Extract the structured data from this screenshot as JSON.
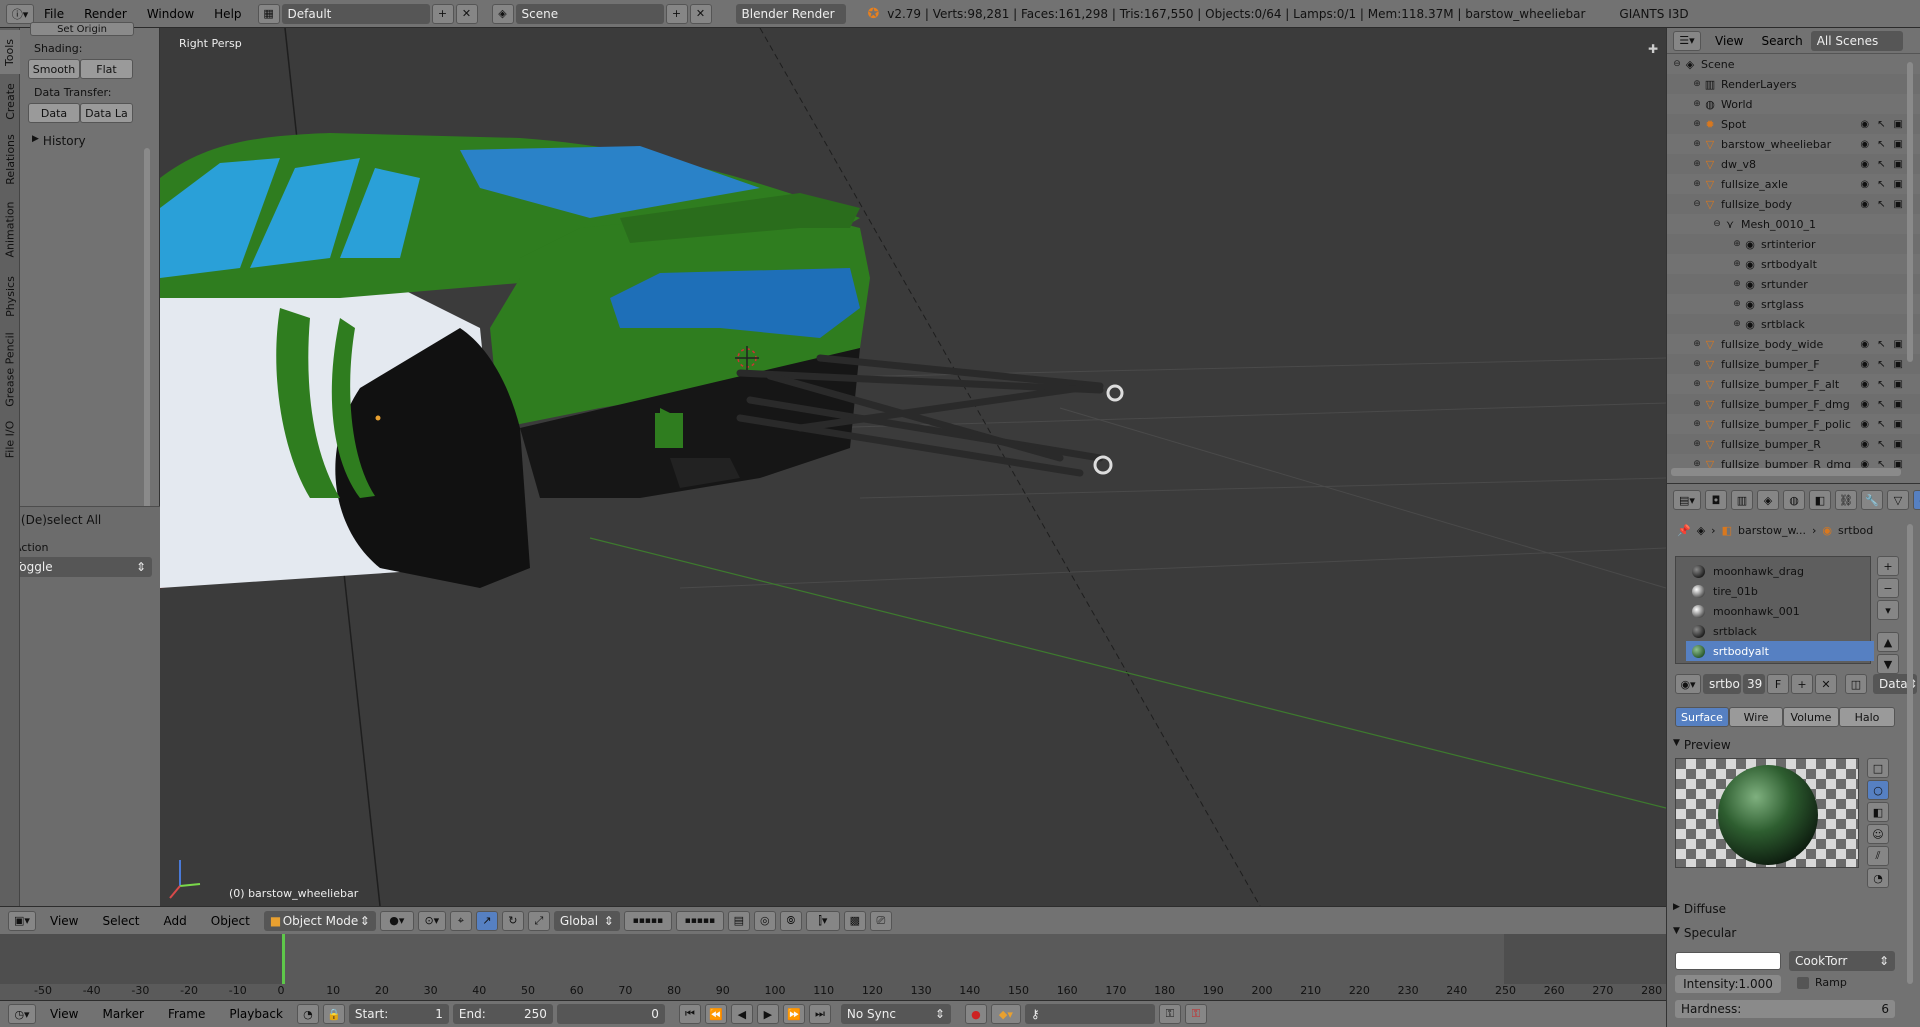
{
  "topbar": {
    "menus": [
      "File",
      "Render",
      "Window",
      "Help"
    ],
    "layout": "Default",
    "scene": "Scene",
    "engine": "Blender Render",
    "stats": "v2.79 | Verts:98,281 | Faces:161,298 | Tris:167,550 | Objects:0/64 | Lamps:0/1 | Mem:118.37M | barstow_wheeliebar",
    "addon": "GIANTS I3D"
  },
  "toolshelf": {
    "tabs": [
      "Tools",
      "Create",
      "Relations",
      "Animation",
      "Physics",
      "Grease Pencil",
      "File I/O"
    ],
    "set_origin": "Set Origin",
    "shading_label": "Shading:",
    "smooth": "Smooth",
    "flat": "Flat",
    "transfer_label": "Data Transfer:",
    "data": "Data",
    "data_la": "Data La",
    "history": "History",
    "op_title": "(De)select All",
    "action_label": "Action",
    "action_value": "Toggle"
  },
  "viewport": {
    "view_name": "Right Persp",
    "object_label": "(0) barstow_wheeliebar"
  },
  "vheader": {
    "menus": [
      "View",
      "Select",
      "Add",
      "Object"
    ],
    "mode": "Object Mode",
    "orientation": "Global"
  },
  "timeline": {
    "ticks": [
      "-50",
      "-40",
      "-30",
      "-20",
      "-10",
      "0",
      "10",
      "20",
      "30",
      "40",
      "50",
      "60",
      "70",
      "80",
      "90",
      "100",
      "110",
      "120",
      "130",
      "140",
      "150",
      "160",
      "170",
      "180",
      "190",
      "200",
      "210",
      "220",
      "230",
      "240",
      "250",
      "260",
      "270",
      "280"
    ],
    "current_frame_tick": "0"
  },
  "tlheader": {
    "menus": [
      "View",
      "Marker",
      "Frame",
      "Playback"
    ],
    "start_label": "Start:",
    "start": "1",
    "end_label": "End:",
    "end": "250",
    "frame": "0",
    "sync": "No Sync"
  },
  "outliner": {
    "menus": [
      "View",
      "Search"
    ],
    "filter": "All Scenes",
    "rows": [
      {
        "name": "Scene",
        "indent": 0,
        "icon": "scene"
      },
      {
        "name": "RenderLayers",
        "indent": 1,
        "icon": "render"
      },
      {
        "name": "World",
        "indent": 1,
        "icon": "world"
      },
      {
        "name": "Spot",
        "indent": 1,
        "icon": "lamp"
      },
      {
        "name": "barstow_wheeliebar",
        "indent": 1,
        "icon": "object"
      },
      {
        "name": "dw_v8",
        "indent": 1,
        "icon": "object"
      },
      {
        "name": "fullsize_axle",
        "indent": 1,
        "icon": "object"
      },
      {
        "name": "fullsize_body",
        "indent": 1,
        "icon": "object"
      },
      {
        "name": "Mesh_0010_1",
        "indent": 2,
        "icon": "mesh"
      },
      {
        "name": "srtinterior",
        "indent": 3,
        "icon": "material"
      },
      {
        "name": "srtbodyalt",
        "indent": 3,
        "icon": "material"
      },
      {
        "name": "srtunder",
        "indent": 3,
        "icon": "material"
      },
      {
        "name": "srtglass",
        "indent": 3,
        "icon": "material"
      },
      {
        "name": "srtblack",
        "indent": 3,
        "icon": "material"
      },
      {
        "name": "fullsize_body_wide",
        "indent": 1,
        "icon": "object"
      },
      {
        "name": "fullsize_bumper_F",
        "indent": 1,
        "icon": "object"
      },
      {
        "name": "fullsize_bumper_F_alt",
        "indent": 1,
        "icon": "object"
      },
      {
        "name": "fullsize_bumper_F_dmg",
        "indent": 1,
        "icon": "object"
      },
      {
        "name": "fullsize_bumper_F_polic",
        "indent": 1,
        "icon": "object"
      },
      {
        "name": "fullsize_bumper_R",
        "indent": 1,
        "icon": "object"
      },
      {
        "name": "fullsize_bumper_R_dmg",
        "indent": 1,
        "icon": "object"
      }
    ]
  },
  "props": {
    "breadcrumb_obj": "barstow_w...",
    "breadcrumb_mat": "srtbod",
    "materials": [
      "moonhawk_drag",
      "tire_01b",
      "moonhawk_001",
      "srtblack",
      "srtbodyalt"
    ],
    "mat_name": "srtbo",
    "users": "39",
    "fake": "F",
    "data_link": "Data",
    "tabs": [
      "Surface",
      "Wire",
      "Volume",
      "Halo"
    ],
    "preview": "Preview",
    "diffuse": "Diffuse",
    "specular": "Specular",
    "spec_shader": "CookTorr",
    "intensity": "Intensity:1.000",
    "ramp": "Ramp",
    "hardness_label": "Hardness:",
    "hardness": "6"
  }
}
